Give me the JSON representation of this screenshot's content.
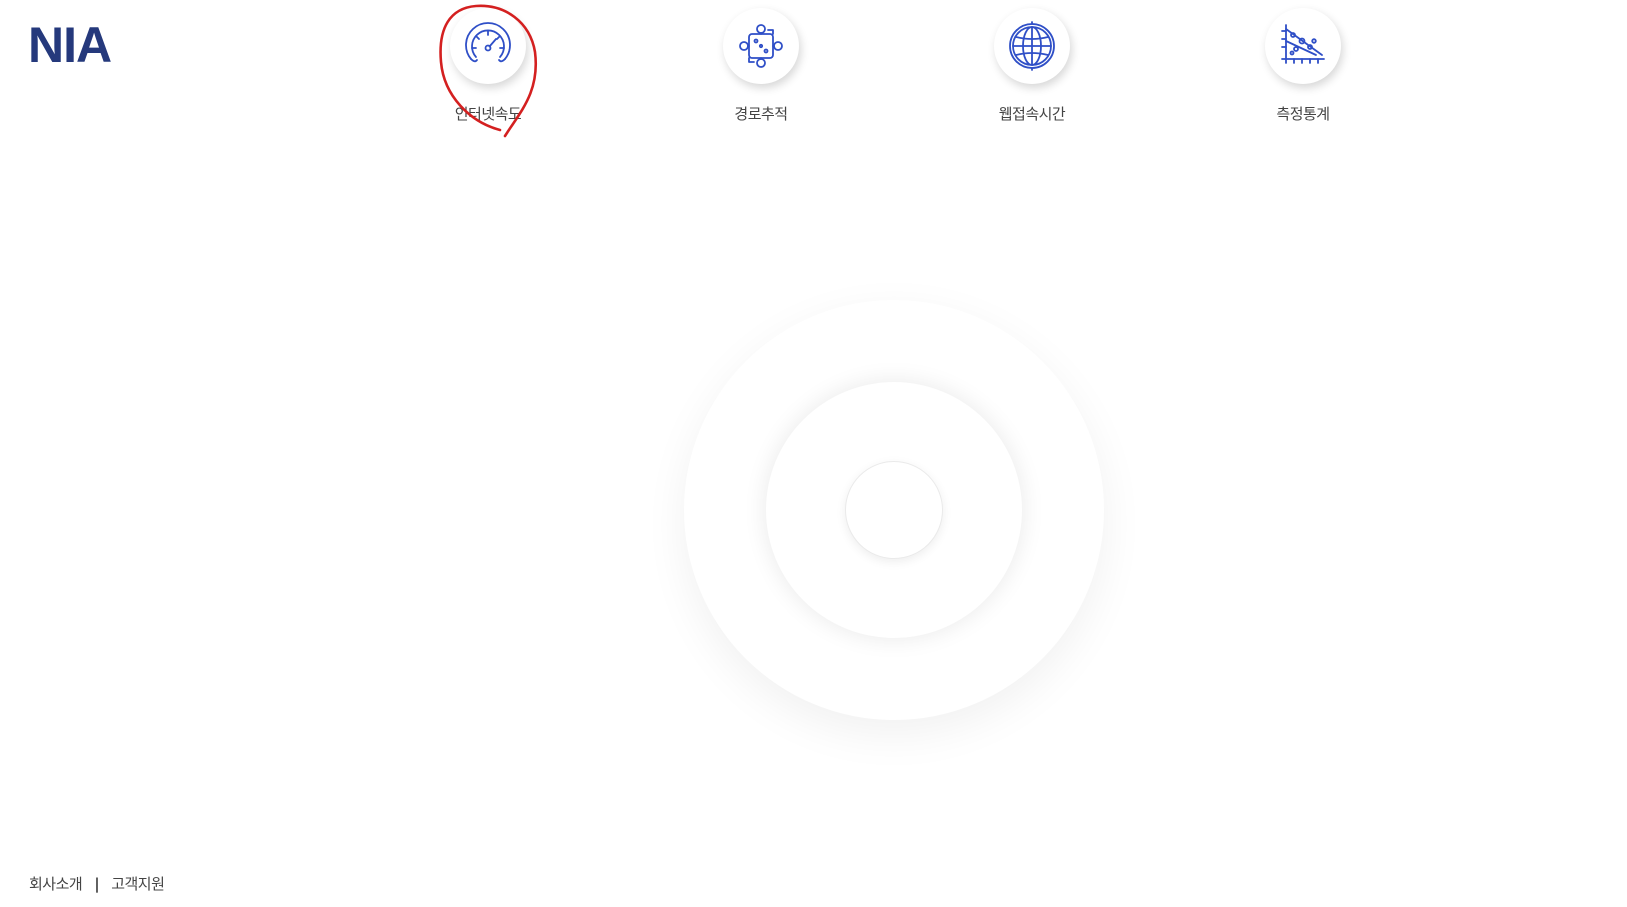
{
  "header": {
    "logo_text": "NIA"
  },
  "nav": {
    "items": [
      {
        "label": "인터넷속도",
        "icon": "speedometer-icon"
      },
      {
        "label": "경로추적",
        "icon": "route-trace-icon"
      },
      {
        "label": "웹접속시간",
        "icon": "globe-icon"
      },
      {
        "label": "측정통계",
        "icon": "statistics-chart-icon"
      }
    ]
  },
  "footer": {
    "links": [
      {
        "label": "회사소개"
      },
      {
        "label": "고객지원"
      }
    ],
    "separator": "|"
  },
  "colors": {
    "brand": "#25397c",
    "icon": "#2f4fc7",
    "annotation": "#d42020",
    "text": "#444444"
  }
}
